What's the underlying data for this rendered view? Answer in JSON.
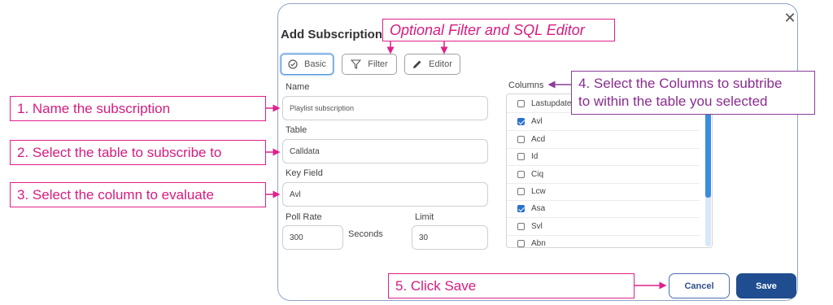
{
  "dialog": {
    "title": "Add Subscription",
    "close_icon": "close-icon",
    "tabs": [
      {
        "label": "Basic",
        "icon": "check-circle-icon",
        "active": true
      },
      {
        "label": "Filter",
        "icon": "filter-icon",
        "active": false
      },
      {
        "label": "Editor",
        "icon": "pencil-icon",
        "active": false
      }
    ],
    "fields": {
      "name_label": "Name",
      "name_value": "Playlist subscription",
      "table_label": "Table",
      "table_value": "Calldata",
      "key_field_label": "Key Field",
      "key_field_value": "Avl",
      "poll_rate_label": "Poll Rate",
      "poll_rate_value": "300",
      "poll_rate_unit": "Seconds",
      "limit_label": "Limit",
      "limit_value": "30"
    },
    "columns": {
      "label": "Columns",
      "items": [
        {
          "name": "Lastupdate",
          "checked": false
        },
        {
          "name": "Avl",
          "checked": true
        },
        {
          "name": "Acd",
          "checked": false
        },
        {
          "name": "Id",
          "checked": false
        },
        {
          "name": "Ciq",
          "checked": false
        },
        {
          "name": "Lcw",
          "checked": false
        },
        {
          "name": "Asa",
          "checked": true
        },
        {
          "name": "Svl",
          "checked": false
        },
        {
          "name": "Abn",
          "checked": false
        }
      ]
    },
    "buttons": {
      "cancel": "Cancel",
      "save": "Save"
    }
  },
  "callouts": {
    "optional": "Optional Filter and SQL Editor",
    "step1": "1. Name the subscription",
    "step2": "2. Select the table to subscribe to",
    "step3": "3. Select the column to evaluate",
    "step4_line1": "4. Select the Columns to subtribe",
    "step4_line2": "to within the table you selected",
    "step5": "5. Click Save"
  },
  "colors": {
    "callout_pink": "#e0218a",
    "callout_purple": "#8a3e9a",
    "primary": "#1f4d8f",
    "checkbox_checked": "#2b6fd0"
  }
}
